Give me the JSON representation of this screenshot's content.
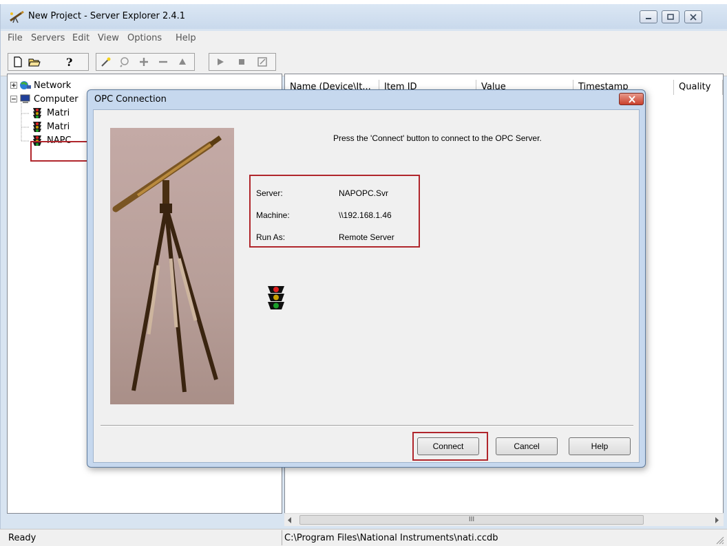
{
  "window": {
    "title": "New Project - Server Explorer 2.4.1"
  },
  "menu": [
    "File",
    "Servers",
    "Edit",
    "View",
    "Options",
    "Help"
  ],
  "tree": {
    "network": "Network",
    "computer": "Computer",
    "servers": [
      "Matri",
      "Matri",
      "NAPC"
    ]
  },
  "columns": [
    "Name (Device\\It...",
    "Item ID",
    "Value",
    "Timestamp",
    "Quality"
  ],
  "hscroll_grip": "III",
  "status": {
    "left": "Ready",
    "right": "C:\\Program Files\\National Instruments\\nati.ccdb"
  },
  "dialog": {
    "title": "OPC Connection",
    "message": "Press the 'Connect' button to connect to the OPC Server.",
    "fields": [
      {
        "label": "Server:",
        "value": "NAPOPC.Svr"
      },
      {
        "label": "Machine:",
        "value": "\\\\192.168.1.46"
      },
      {
        "label": "Run As:",
        "value": "Remote Server"
      }
    ],
    "buttons": {
      "connect": "Connect",
      "cancel": "Cancel",
      "help": "Help"
    }
  },
  "colors": {
    "highlight": "#b0252b",
    "traffic_red": "#e02020",
    "traffic_yellow": "#c8a000",
    "traffic_green": "#1aa02a"
  },
  "icons": [
    "app-telescope-icon",
    "minimize-icon",
    "maximize-icon",
    "close-icon",
    "new-file-icon",
    "open-folder-icon",
    "about-icon",
    "wizard-icon",
    "browse-icon",
    "add-icon",
    "remove-icon",
    "up-icon",
    "play-icon",
    "stop-icon",
    "log-icon",
    "network-icon",
    "computer-icon",
    "traffic-light-icon",
    "telescope-photo"
  ]
}
